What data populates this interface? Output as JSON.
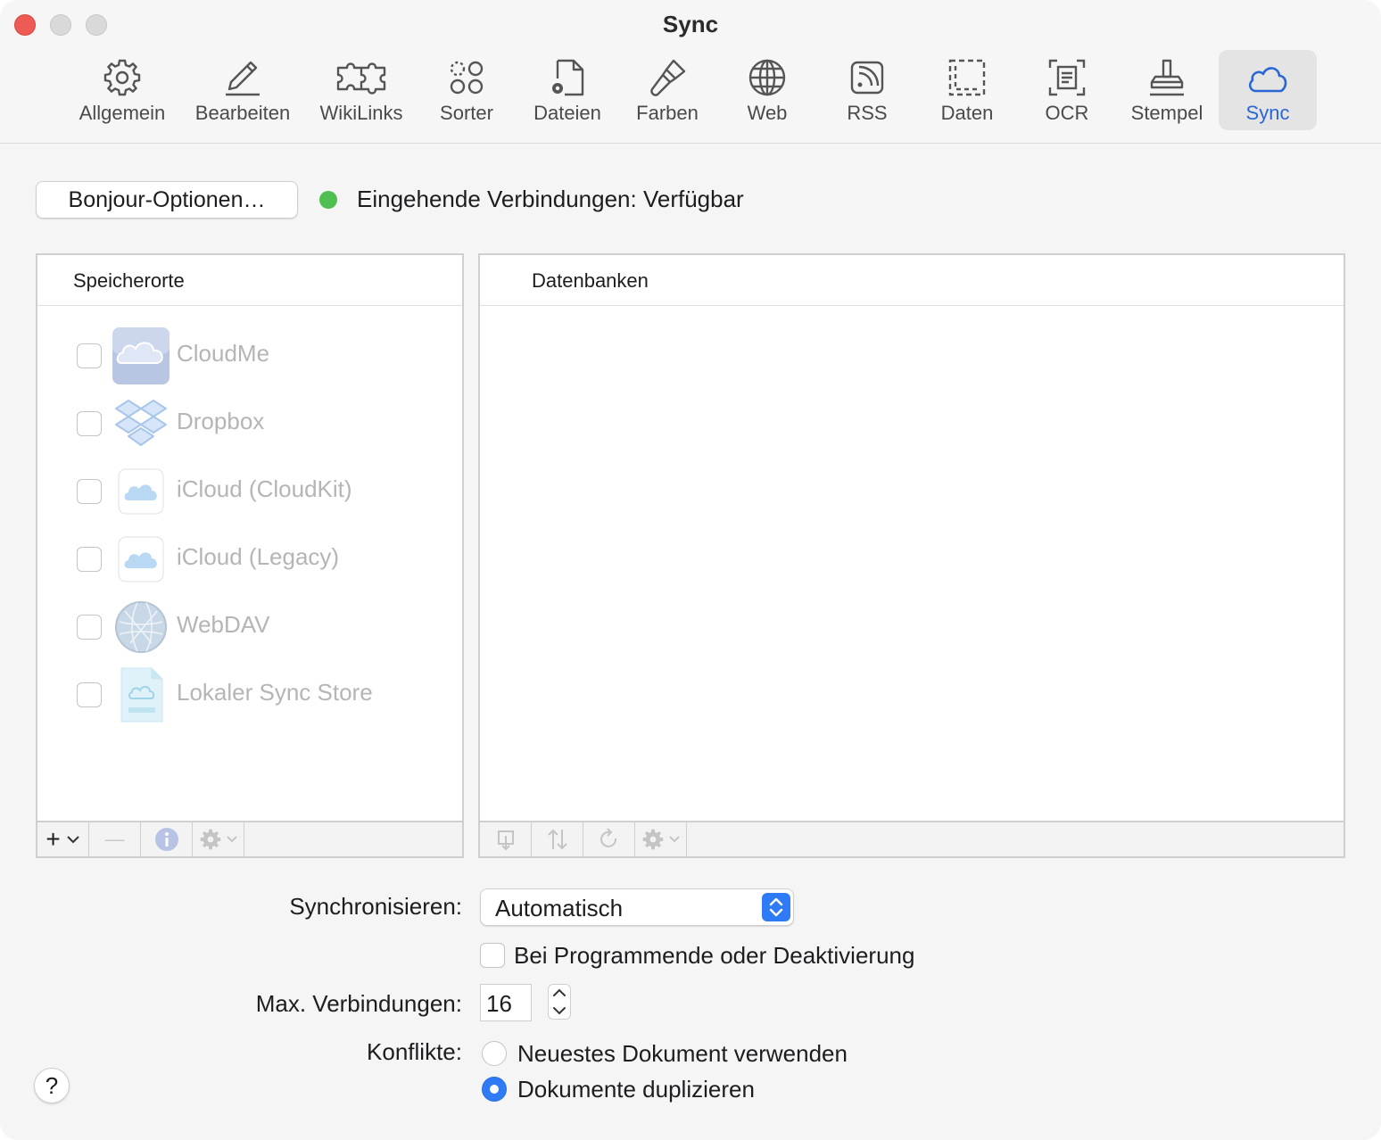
{
  "window": {
    "title": "Sync"
  },
  "toolbar": {
    "items": [
      {
        "label": "Allgemein",
        "icon": "gear-icon"
      },
      {
        "label": "Bearbeiten",
        "icon": "pencil-icon"
      },
      {
        "label": "WikiLinks",
        "icon": "puzzle-icon"
      },
      {
        "label": "Sorter",
        "icon": "sorter-icon"
      },
      {
        "label": "Dateien",
        "icon": "document-gear-icon"
      },
      {
        "label": "Farben",
        "icon": "paintbrush-icon"
      },
      {
        "label": "Web",
        "icon": "globe-icon"
      },
      {
        "label": "RSS",
        "icon": "rss-icon"
      },
      {
        "label": "Daten",
        "icon": "dashed-frame-icon"
      },
      {
        "label": "OCR",
        "icon": "ocr-icon"
      },
      {
        "label": "Stempel",
        "icon": "stamp-icon"
      },
      {
        "label": "Sync",
        "icon": "cloud-icon",
        "active": true
      }
    ],
    "accent_color": "#2b66d6"
  },
  "bonjour": {
    "button_label": "Bonjour-Optionen…",
    "status_text": "Eingehende Verbindungen: Verfügbar",
    "status_color": "#4fbf4f"
  },
  "locations": {
    "header": "Speicherorte",
    "items": [
      {
        "name": "CloudMe",
        "icon": "cloudme-icon",
        "checked": false
      },
      {
        "name": "Dropbox",
        "icon": "dropbox-icon",
        "checked": false
      },
      {
        "name": "iCloud (CloudKit)",
        "icon": "icloud-icon",
        "checked": false
      },
      {
        "name": "iCloud (Legacy)",
        "icon": "icloud-icon",
        "checked": false
      },
      {
        "name": "WebDAV",
        "icon": "webdav-globe-icon",
        "checked": false
      },
      {
        "name": "Lokaler Sync Store",
        "icon": "local-sync-store-icon",
        "checked": false
      }
    ],
    "footer": {
      "add": "+",
      "remove": "—"
    }
  },
  "databases": {
    "header": "Datenbanken"
  },
  "settings": {
    "sync_label": "Synchronisieren:",
    "sync_value": "Automatisch",
    "on_quit_label": "Bei Programmende oder Deaktivierung",
    "max_conn_label": "Max. Verbindungen:",
    "max_conn_value": "16",
    "conflicts_label": "Konflikte:",
    "conflict_options": [
      {
        "label": "Neuestes Dokument verwenden",
        "selected": false
      },
      {
        "label": "Dokumente duplizieren",
        "selected": true
      }
    ]
  },
  "help": {
    "label": "?"
  }
}
